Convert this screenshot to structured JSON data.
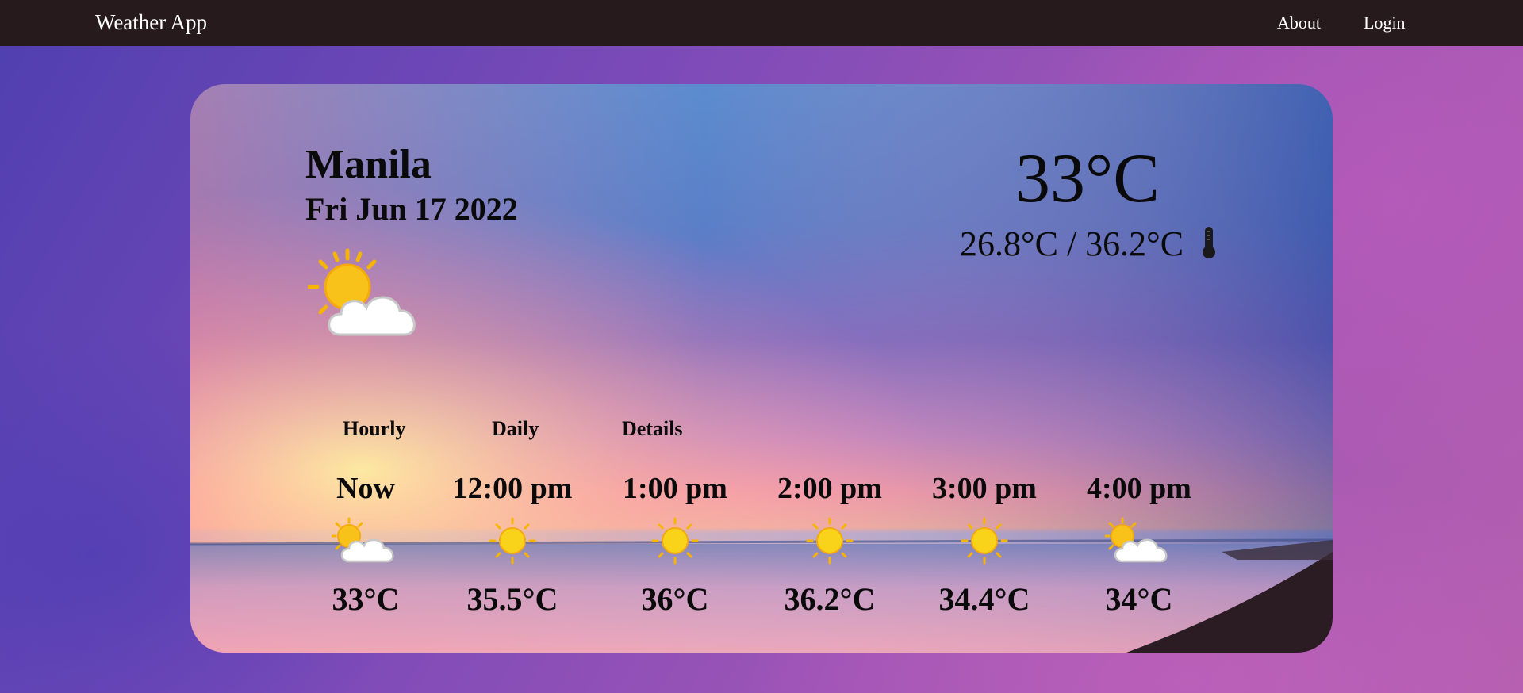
{
  "nav": {
    "brand": "Weather App",
    "links": [
      "About",
      "Login"
    ]
  },
  "current": {
    "city": "Manila",
    "date": "Fri Jun 17 2022",
    "icon": "sun-behind-cloud-icon",
    "temperature": "33°C",
    "range": "26.8°C / 36.2°C",
    "range_icon": "thermometer-icon"
  },
  "tabs": [
    "Hourly",
    "Daily",
    "Details"
  ],
  "hourly": [
    {
      "time": "Now",
      "icon": "sun-behind-cloud-icon",
      "temp": "33°C"
    },
    {
      "time": "12:00 pm",
      "icon": "sun-icon",
      "temp": "35.5°C"
    },
    {
      "time": "1:00 pm",
      "icon": "sun-icon",
      "temp": "36°C"
    },
    {
      "time": "2:00 pm",
      "icon": "sun-icon",
      "temp": "36.2°C"
    },
    {
      "time": "3:00 pm",
      "icon": "sun-icon",
      "temp": "34.4°C"
    },
    {
      "time": "4:00 pm",
      "icon": "sun-behind-cloud-icon",
      "temp": "34°C"
    }
  ],
  "colors": {
    "navbar": "#261a1c",
    "text": "#0a0a0a",
    "sun": "#f7c21a",
    "cloud": "#ffffff"
  }
}
